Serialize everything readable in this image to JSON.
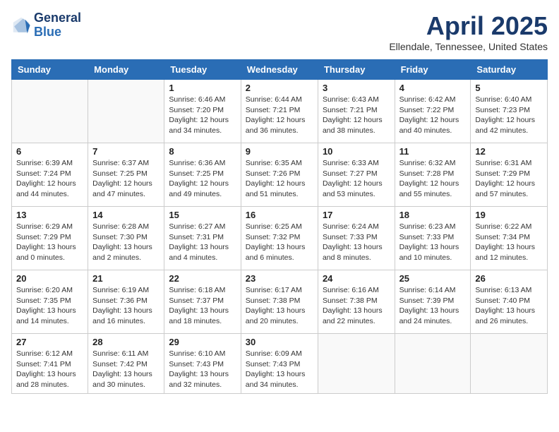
{
  "header": {
    "logo_line1": "General",
    "logo_line2": "Blue",
    "month": "April 2025",
    "location": "Ellendale, Tennessee, United States"
  },
  "weekdays": [
    "Sunday",
    "Monday",
    "Tuesday",
    "Wednesday",
    "Thursday",
    "Friday",
    "Saturday"
  ],
  "weeks": [
    [
      {
        "day": "",
        "sunrise": "",
        "sunset": "",
        "daylight": ""
      },
      {
        "day": "",
        "sunrise": "",
        "sunset": "",
        "daylight": ""
      },
      {
        "day": "1",
        "sunrise": "Sunrise: 6:46 AM",
        "sunset": "Sunset: 7:20 PM",
        "daylight": "Daylight: 12 hours and 34 minutes."
      },
      {
        "day": "2",
        "sunrise": "Sunrise: 6:44 AM",
        "sunset": "Sunset: 7:21 PM",
        "daylight": "Daylight: 12 hours and 36 minutes."
      },
      {
        "day": "3",
        "sunrise": "Sunrise: 6:43 AM",
        "sunset": "Sunset: 7:21 PM",
        "daylight": "Daylight: 12 hours and 38 minutes."
      },
      {
        "day": "4",
        "sunrise": "Sunrise: 6:42 AM",
        "sunset": "Sunset: 7:22 PM",
        "daylight": "Daylight: 12 hours and 40 minutes."
      },
      {
        "day": "5",
        "sunrise": "Sunrise: 6:40 AM",
        "sunset": "Sunset: 7:23 PM",
        "daylight": "Daylight: 12 hours and 42 minutes."
      }
    ],
    [
      {
        "day": "6",
        "sunrise": "Sunrise: 6:39 AM",
        "sunset": "Sunset: 7:24 PM",
        "daylight": "Daylight: 12 hours and 44 minutes."
      },
      {
        "day": "7",
        "sunrise": "Sunrise: 6:37 AM",
        "sunset": "Sunset: 7:25 PM",
        "daylight": "Daylight: 12 hours and 47 minutes."
      },
      {
        "day": "8",
        "sunrise": "Sunrise: 6:36 AM",
        "sunset": "Sunset: 7:25 PM",
        "daylight": "Daylight: 12 hours and 49 minutes."
      },
      {
        "day": "9",
        "sunrise": "Sunrise: 6:35 AM",
        "sunset": "Sunset: 7:26 PM",
        "daylight": "Daylight: 12 hours and 51 minutes."
      },
      {
        "day": "10",
        "sunrise": "Sunrise: 6:33 AM",
        "sunset": "Sunset: 7:27 PM",
        "daylight": "Daylight: 12 hours and 53 minutes."
      },
      {
        "day": "11",
        "sunrise": "Sunrise: 6:32 AM",
        "sunset": "Sunset: 7:28 PM",
        "daylight": "Daylight: 12 hours and 55 minutes."
      },
      {
        "day": "12",
        "sunrise": "Sunrise: 6:31 AM",
        "sunset": "Sunset: 7:29 PM",
        "daylight": "Daylight: 12 hours and 57 minutes."
      }
    ],
    [
      {
        "day": "13",
        "sunrise": "Sunrise: 6:29 AM",
        "sunset": "Sunset: 7:29 PM",
        "daylight": "Daylight: 13 hours and 0 minutes."
      },
      {
        "day": "14",
        "sunrise": "Sunrise: 6:28 AM",
        "sunset": "Sunset: 7:30 PM",
        "daylight": "Daylight: 13 hours and 2 minutes."
      },
      {
        "day": "15",
        "sunrise": "Sunrise: 6:27 AM",
        "sunset": "Sunset: 7:31 PM",
        "daylight": "Daylight: 13 hours and 4 minutes."
      },
      {
        "day": "16",
        "sunrise": "Sunrise: 6:25 AM",
        "sunset": "Sunset: 7:32 PM",
        "daylight": "Daylight: 13 hours and 6 minutes."
      },
      {
        "day": "17",
        "sunrise": "Sunrise: 6:24 AM",
        "sunset": "Sunset: 7:33 PM",
        "daylight": "Daylight: 13 hours and 8 minutes."
      },
      {
        "day": "18",
        "sunrise": "Sunrise: 6:23 AM",
        "sunset": "Sunset: 7:33 PM",
        "daylight": "Daylight: 13 hours and 10 minutes."
      },
      {
        "day": "19",
        "sunrise": "Sunrise: 6:22 AM",
        "sunset": "Sunset: 7:34 PM",
        "daylight": "Daylight: 13 hours and 12 minutes."
      }
    ],
    [
      {
        "day": "20",
        "sunrise": "Sunrise: 6:20 AM",
        "sunset": "Sunset: 7:35 PM",
        "daylight": "Daylight: 13 hours and 14 minutes."
      },
      {
        "day": "21",
        "sunrise": "Sunrise: 6:19 AM",
        "sunset": "Sunset: 7:36 PM",
        "daylight": "Daylight: 13 hours and 16 minutes."
      },
      {
        "day": "22",
        "sunrise": "Sunrise: 6:18 AM",
        "sunset": "Sunset: 7:37 PM",
        "daylight": "Daylight: 13 hours and 18 minutes."
      },
      {
        "day": "23",
        "sunrise": "Sunrise: 6:17 AM",
        "sunset": "Sunset: 7:38 PM",
        "daylight": "Daylight: 13 hours and 20 minutes."
      },
      {
        "day": "24",
        "sunrise": "Sunrise: 6:16 AM",
        "sunset": "Sunset: 7:38 PM",
        "daylight": "Daylight: 13 hours and 22 minutes."
      },
      {
        "day": "25",
        "sunrise": "Sunrise: 6:14 AM",
        "sunset": "Sunset: 7:39 PM",
        "daylight": "Daylight: 13 hours and 24 minutes."
      },
      {
        "day": "26",
        "sunrise": "Sunrise: 6:13 AM",
        "sunset": "Sunset: 7:40 PM",
        "daylight": "Daylight: 13 hours and 26 minutes."
      }
    ],
    [
      {
        "day": "27",
        "sunrise": "Sunrise: 6:12 AM",
        "sunset": "Sunset: 7:41 PM",
        "daylight": "Daylight: 13 hours and 28 minutes."
      },
      {
        "day": "28",
        "sunrise": "Sunrise: 6:11 AM",
        "sunset": "Sunset: 7:42 PM",
        "daylight": "Daylight: 13 hours and 30 minutes."
      },
      {
        "day": "29",
        "sunrise": "Sunrise: 6:10 AM",
        "sunset": "Sunset: 7:43 PM",
        "daylight": "Daylight: 13 hours and 32 minutes."
      },
      {
        "day": "30",
        "sunrise": "Sunrise: 6:09 AM",
        "sunset": "Sunset: 7:43 PM",
        "daylight": "Daylight: 13 hours and 34 minutes."
      },
      {
        "day": "",
        "sunrise": "",
        "sunset": "",
        "daylight": ""
      },
      {
        "day": "",
        "sunrise": "",
        "sunset": "",
        "daylight": ""
      },
      {
        "day": "",
        "sunrise": "",
        "sunset": "",
        "daylight": ""
      }
    ]
  ]
}
